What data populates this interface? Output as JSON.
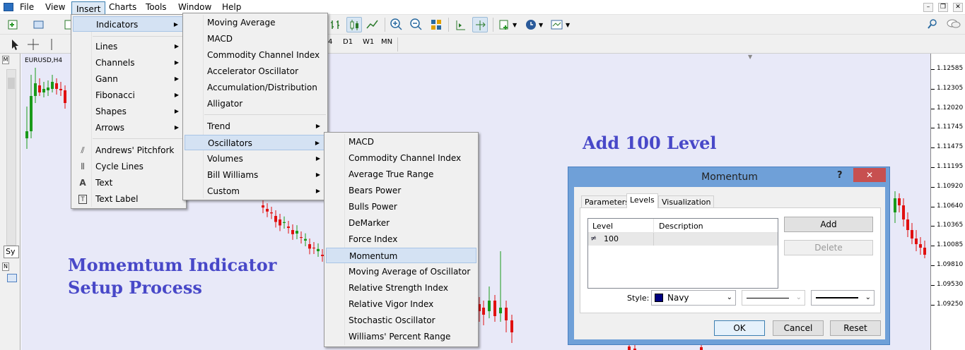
{
  "menubar": {
    "items": [
      "File",
      "View",
      "Insert",
      "Charts",
      "Tools",
      "Window",
      "Help"
    ]
  },
  "toolbar2": {
    "timeframes": [
      "4",
      "D1",
      "W1",
      "MN"
    ]
  },
  "chart": {
    "symbol_label": "EURUSD,H4",
    "left_tab": "Sy",
    "axis_ticks": [
      "1.12585",
      "1.12305",
      "1.12020",
      "1.11745",
      "1.11475",
      "1.11195",
      "1.10920",
      "1.10640",
      "1.10365",
      "1.10085",
      "1.09810",
      "1.09530",
      "1.09250"
    ],
    "overlay_title_1": "Momemtum Indicator",
    "overlay_title_2": "Setup Process",
    "overlay_note": "Add 100 Level"
  },
  "insert_menu": {
    "items": [
      {
        "label": "Indicators",
        "arrow": true
      },
      {
        "label": "Lines",
        "arrow": true
      },
      {
        "label": "Channels",
        "arrow": true
      },
      {
        "label": "Gann",
        "arrow": true
      },
      {
        "label": "Fibonacci",
        "arrow": true
      },
      {
        "label": "Shapes",
        "arrow": true
      },
      {
        "label": "Arrows",
        "arrow": true
      },
      {
        "label": "Andrews' Pitchfork",
        "arrow": false
      },
      {
        "label": "Cycle Lines",
        "arrow": false
      },
      {
        "label": "Text",
        "arrow": false
      },
      {
        "label": "Text Label",
        "arrow": false
      }
    ]
  },
  "indicators_menu": {
    "items": [
      {
        "label": "Moving Average"
      },
      {
        "label": "MACD"
      },
      {
        "label": "Commodity Channel Index"
      },
      {
        "label": "Accelerator Oscillator"
      },
      {
        "label": "Accumulation/Distribution"
      },
      {
        "label": "Alligator"
      },
      {
        "label": "Trend"
      },
      {
        "label": "Oscillators"
      },
      {
        "label": "Volumes"
      },
      {
        "label": "Bill Williams"
      },
      {
        "label": "Custom"
      }
    ]
  },
  "oscillators_menu": {
    "items": [
      "MACD",
      "Commodity Channel Index",
      "Average True Range",
      "Bears Power",
      "Bulls Power",
      "DeMarker",
      "Force Index",
      "Momentum",
      "Moving Average of Oscillator",
      "Relative Strength Index",
      "Relative Vigor Index",
      "Stochastic Oscillator",
      "Williams' Percent Range"
    ]
  },
  "dialog": {
    "title": "Momentum",
    "help": "?",
    "close": "✕",
    "tabs": [
      "Parameters",
      "Levels",
      "Visualization"
    ],
    "columns": [
      "Level",
      "Description"
    ],
    "row_level": "100",
    "row_description": "",
    "add": "Add",
    "delete": "Delete",
    "style_label": "Style:",
    "color_name": "Navy",
    "ok": "OK",
    "cancel": "Cancel",
    "reset": "Reset"
  },
  "colors": {
    "bull": "#1a9a1a",
    "bear": "#e01010",
    "chart_bg": "#e8e9f8",
    "overlay": "#4848c8",
    "navy": "#000080"
  }
}
